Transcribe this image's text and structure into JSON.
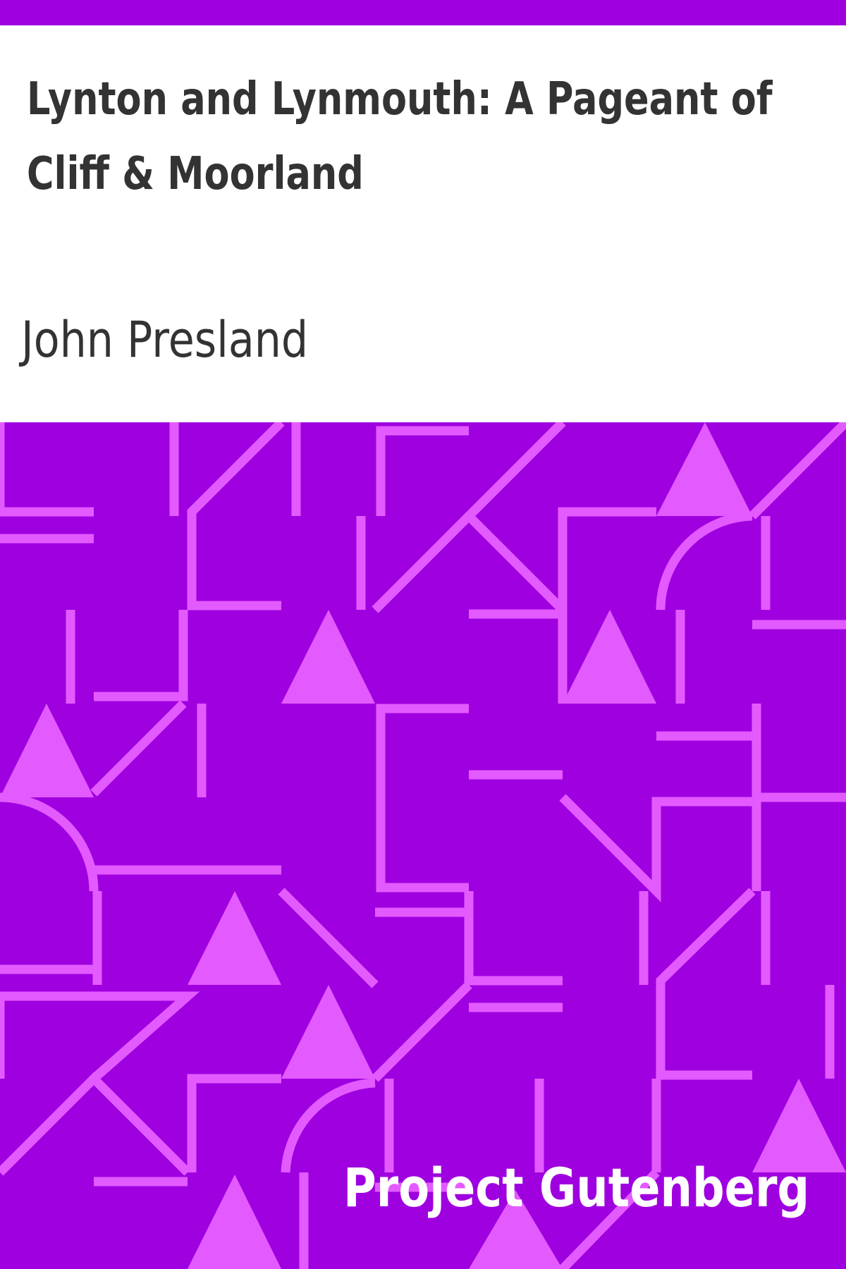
{
  "book": {
    "title": "Lynton and Lynmouth: A Pageant of Cliff & Moorland",
    "author": "John Presland"
  },
  "publisher": {
    "name": "Project Gutenberg"
  },
  "colors": {
    "band": "#9f00df",
    "pattern_background": "#9f00df",
    "pattern_stroke": "#e35bff",
    "title_text": "#333333",
    "brand_text": "#ffffff"
  }
}
